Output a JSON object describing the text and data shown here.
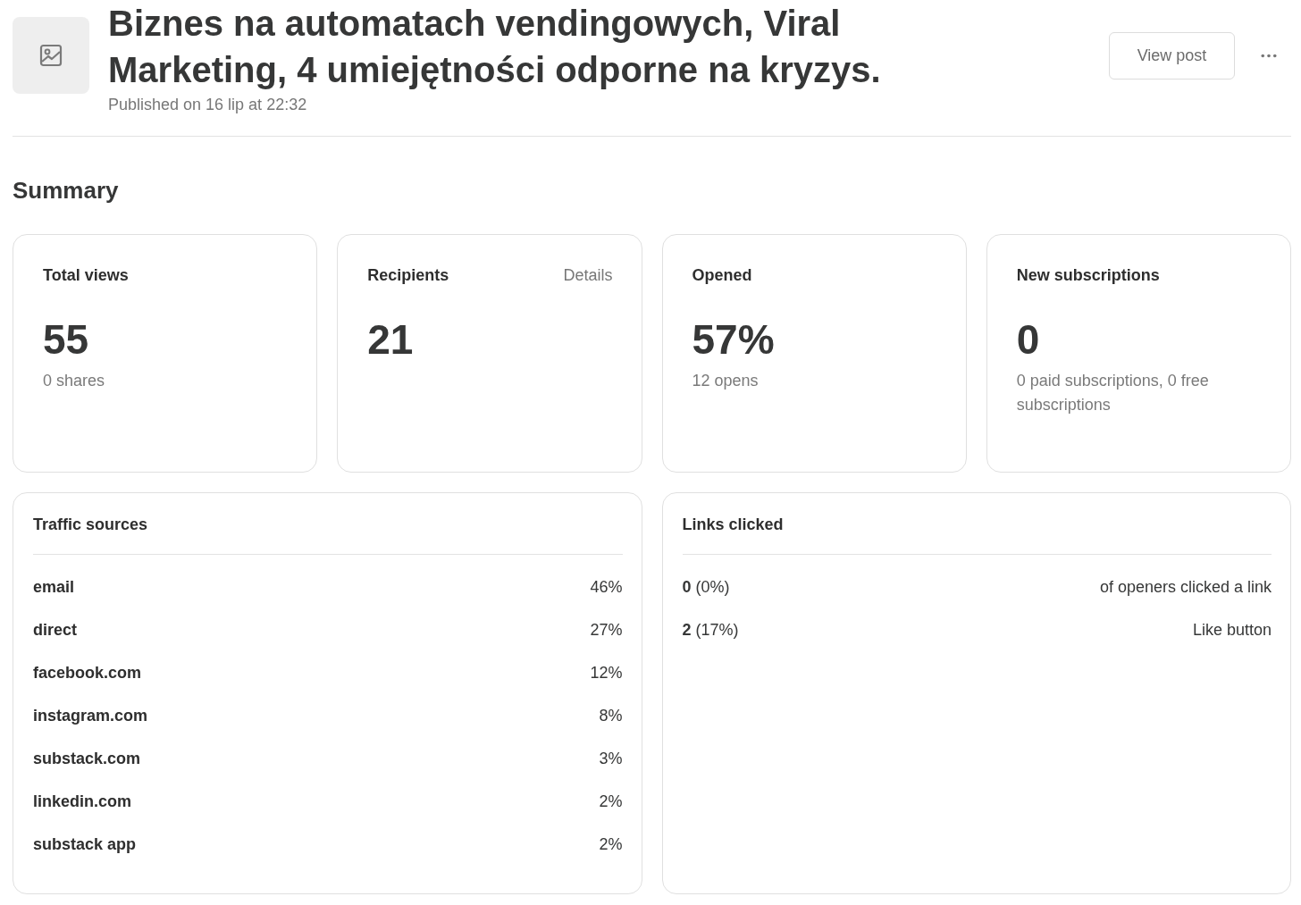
{
  "post": {
    "title": "Biznes na automatach vendingowych, Viral Marketing, 4 umiejętności odporne na kryzys.",
    "published": "Published on 16 lip at 22:32",
    "view_button": "View post"
  },
  "summary": {
    "heading": "Summary",
    "cards": [
      {
        "label": "Total views",
        "value": "55",
        "detail": "0 shares"
      },
      {
        "label": "Recipients",
        "link": "Details",
        "value": "21"
      },
      {
        "label": "Opened",
        "value": "57%",
        "detail": "12 opens"
      },
      {
        "label": "New subscriptions",
        "value": "0",
        "detail": "0 paid subscriptions, 0 free subscriptions"
      }
    ]
  },
  "traffic_sources": {
    "title": "Traffic sources",
    "rows": [
      {
        "source": "email",
        "share": "46%"
      },
      {
        "source": "direct",
        "share": "27%"
      },
      {
        "source": "facebook.com",
        "share": "12%"
      },
      {
        "source": "instagram.com",
        "share": "8%"
      },
      {
        "source": "substack.com",
        "share": "3%"
      },
      {
        "source": "linkedin.com",
        "share": "2%"
      },
      {
        "source": "substack app",
        "share": "2%"
      }
    ]
  },
  "links_clicked": {
    "title": "Links clicked",
    "rows": [
      {
        "count": "**0** (0%)",
        "label": "of openers clicked a link"
      },
      {
        "count": "**2** (17%)",
        "label": "Like button"
      }
    ]
  }
}
